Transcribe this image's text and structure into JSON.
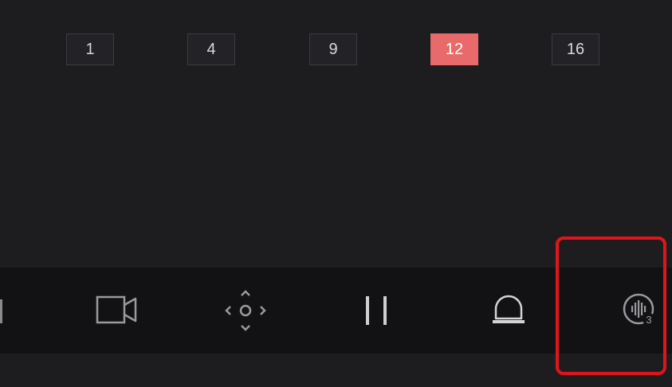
{
  "layout_buttons": [
    {
      "label": "1",
      "active": false
    },
    {
      "label": "4",
      "active": false
    },
    {
      "label": "9",
      "active": false
    },
    {
      "label": "12",
      "active": true
    },
    {
      "label": "16",
      "active": false
    }
  ],
  "toolbar": {
    "items": [
      {
        "icon": "record-icon"
      },
      {
        "icon": "ptz-control-icon"
      },
      {
        "icon": "pause-icon"
      },
      {
        "icon": "alarm-icon"
      },
      {
        "icon": "two-way-audio-icon",
        "badge": "3"
      }
    ]
  },
  "colors": {
    "background": "#1d1d20",
    "toolbar": "#121214",
    "active_button": "#e86a6a",
    "highlight": "#e0151c"
  }
}
